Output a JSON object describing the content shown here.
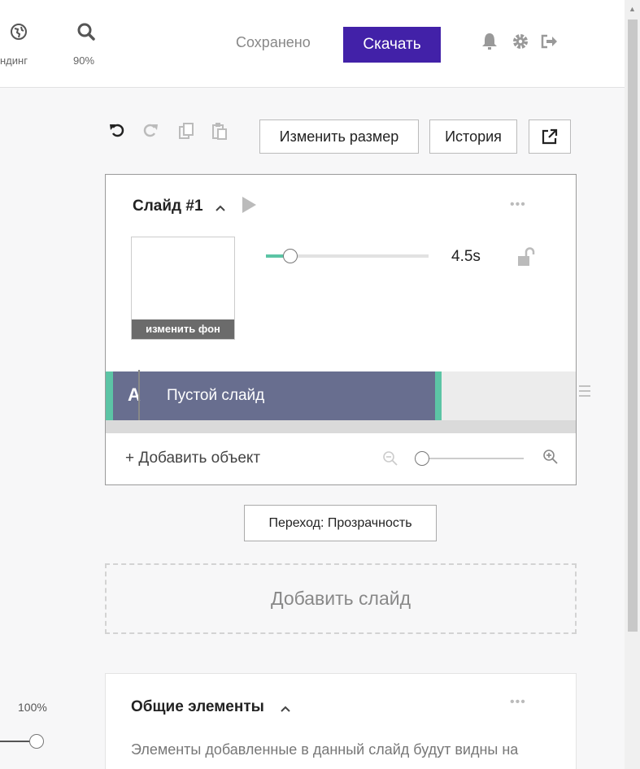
{
  "topbar": {
    "branding_icon": "globe-icon",
    "branding_label": "ндинг",
    "zoom_icon": "search-icon",
    "zoom_label": "90%",
    "saved_status": "Сохранено",
    "download_label": "Скачать",
    "download_color": "#4221a8",
    "right_icons": [
      "bell-icon",
      "gear-icon",
      "logout-icon"
    ]
  },
  "toolbar": {
    "icons": [
      "undo-icon",
      "redo-icon",
      "copy-icon",
      "paste-icon"
    ],
    "resize_label": "Изменить размер",
    "history_label": "История",
    "external_icon": "external-link-icon"
  },
  "slide": {
    "title": "Слайд #1",
    "chevron": "^",
    "menu_dots": "•••",
    "thumbnail_label": "изменить фон",
    "duration": "4.5s",
    "duration_slider_fraction": 0.15,
    "lock_icon": "unlock-icon",
    "track_type_letter": "A",
    "track_label": "Пустой слайд",
    "track_color": "#686e8f",
    "accent_color": "#5cc4a5",
    "add_object_label": "+ Добавить объект",
    "timeline_zoom_fraction": 0.07
  },
  "transition_label": "Переход: Прозрачность",
  "add_slide_label": "Добавить слайд",
  "common": {
    "title": "Общие элементы",
    "chevron": "^",
    "menu_dots": "•••",
    "description": "Элементы добавленные в данный слайд будут видны на всем протяжении видео"
  },
  "left_panel": {
    "zoom_label": "100%"
  }
}
